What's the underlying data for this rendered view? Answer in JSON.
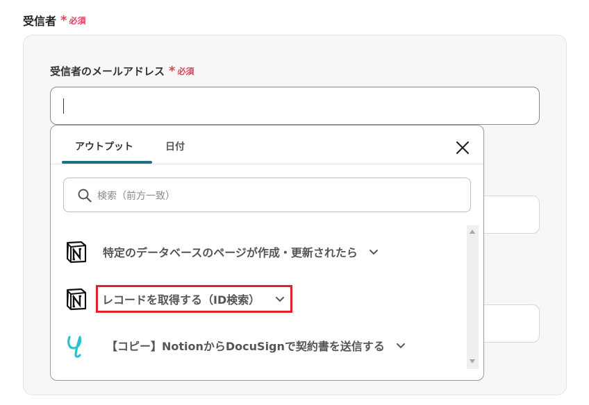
{
  "recipient_section": {
    "label": "受信者",
    "required_mark": "*",
    "required_text": "必須"
  },
  "email_field": {
    "label": "受信者のメールアドレス",
    "required_mark": "*",
    "required_text": "必須",
    "value": ""
  },
  "popover": {
    "tabs": [
      {
        "label": "アウトプット",
        "active": true
      },
      {
        "label": "日付",
        "active": false
      }
    ],
    "search": {
      "placeholder": "検索（前方一致）"
    },
    "items": [
      {
        "label": "特定のデータベースのページが作成・更新されたら",
        "icon": "notion-logo-icon"
      },
      {
        "label": "レコードを取得する（ID検索）",
        "icon": "notion-logo-icon",
        "highlighted": true
      },
      {
        "label": "【コピー】NotionからDocuSignで契約書を送信する",
        "icon": "docusign-logo-icon"
      }
    ]
  },
  "colors": {
    "required": "#e0405a",
    "tab_underline": "#1f6f86",
    "highlight_border": "#e0202a",
    "docusign_teal": "#2dc2c9"
  }
}
